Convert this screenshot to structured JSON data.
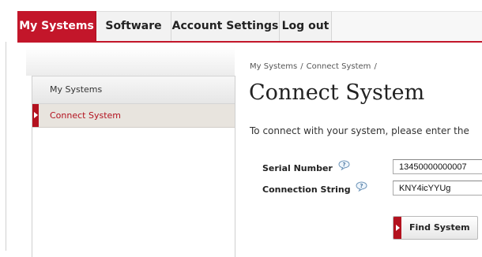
{
  "nav": {
    "tabs": [
      {
        "label": "My Systems",
        "active": true
      },
      {
        "label": "Software",
        "active": false
      },
      {
        "label": "Account Settings",
        "active": false
      },
      {
        "label": "Log out",
        "active": false
      }
    ]
  },
  "sidebar": {
    "header": "My Systems",
    "items": [
      {
        "label": "Connect System",
        "active": true,
        "icon": "chevron-right-icon"
      }
    ]
  },
  "main": {
    "breadcrumb": [
      "My Systems",
      "Connect System"
    ],
    "breadcrumb_separator": "/",
    "title": "Connect System",
    "intro": "To connect with your system, please enter the",
    "fields": [
      {
        "label": "Serial Number",
        "value": "13450000000007",
        "help_icon": "help-bubble-icon"
      },
      {
        "label": "Connection String",
        "value": "KNY4icYYUg",
        "help_icon": "help-bubble-icon"
      }
    ],
    "submit_label": "Find System"
  },
  "colors": {
    "accent": "#c3162a",
    "sidebar_active_bg": "#e8e4de",
    "link_red": "#b3121f"
  }
}
